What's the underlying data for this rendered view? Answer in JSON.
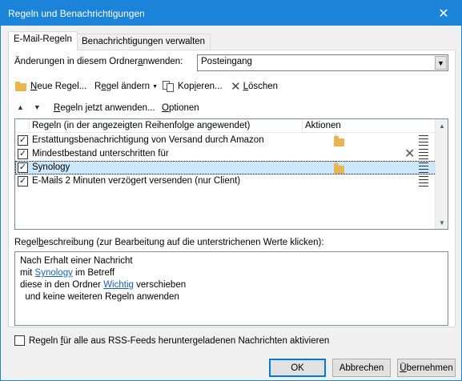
{
  "window": {
    "title": "Regeln und Benachrichtigungen",
    "close_glyph": "✕"
  },
  "tabs": [
    {
      "label": "E-Mail-Regeln",
      "active": true
    },
    {
      "label": "Benachrichtigungen verwalten",
      "active": false
    }
  ],
  "folder_row": {
    "label_prefix": "Änderungen in diesem Ordner ",
    "label_u": "a",
    "label_suffix": "nwenden:",
    "selected": "Posteingang"
  },
  "toolbar": {
    "new_u": "N",
    "new_rest": "eue Regel...",
    "change_pre": "R",
    "change_u": "e",
    "change_rest": "gel ändern",
    "copy_pre": "Kop",
    "copy_u": "i",
    "copy_rest": "eren...",
    "delete_u": "L",
    "delete_rest": "öschen"
  },
  "toolbar2": {
    "apply_u": "R",
    "apply_rest": "egeln jetzt anwenden...",
    "options_u": "O",
    "options_rest": "ptionen"
  },
  "rules_list": {
    "col_rules": "Regeln (in der angezeigten Reihenfolge angewendet)",
    "col_actions": "Aktionen",
    "rows": [
      {
        "label": "Erstattungsbenachrichtigung von Versand durch Amazon",
        "checked": true,
        "selected": false
      },
      {
        "label": "Mindestbestand unterschritten für",
        "checked": true,
        "selected": false
      },
      {
        "label": "Synology",
        "checked": true,
        "selected": true
      },
      {
        "label": "E-Mails 2 Minuten verzögert versenden  (nur Client)",
        "checked": true,
        "selected": false
      }
    ]
  },
  "description": {
    "label_pre": "Regel",
    "label_u": "b",
    "label_rest": "eschreibung (zur Bearbeitung auf die unterstrichenen Werte klicken):",
    "line1": "Nach Erhalt einer Nachricht",
    "line2_pre": "mit ",
    "line2_link": "Synology",
    "line2_post": " im Betreff",
    "line3_pre": "diese in den Ordner ",
    "line3_link": "Wichtig",
    "line3_post": " verschieben",
    "line4": "  und keine weiteren Regeln anwenden"
  },
  "rss": {
    "pre": "Regeln ",
    "u": "f",
    "rest": "ür alle aus RSS-Feeds heruntergeladenen Nachrichten aktivieren"
  },
  "buttons": {
    "ok": "OK",
    "cancel": "Abbrechen",
    "apply_u": "Ü",
    "apply_rest": "bernehmen"
  }
}
